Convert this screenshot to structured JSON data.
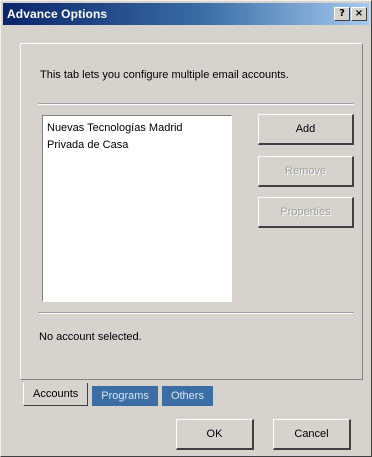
{
  "window": {
    "title": "Advance Options",
    "help_label": "?",
    "close_label": "×"
  },
  "accounts_tab": {
    "description": "This tab lets you configure multiple email accounts.",
    "accounts": [
      "Nuevas Tecnologías Madrid",
      "Privada de Casa"
    ],
    "buttons": {
      "add": "Add",
      "remove": "Remove",
      "properties": "Properties"
    },
    "status": "No account selected."
  },
  "tabs": [
    {
      "label": "Accounts",
      "active": true
    },
    {
      "label": "Programs",
      "active": false
    },
    {
      "label": "Others",
      "active": false
    }
  ],
  "footer": {
    "ok": "OK",
    "cancel": "Cancel"
  },
  "colors": {
    "face": "#d6d3ce",
    "title_start": "#0a246a",
    "title_end": "#a6caf0",
    "inactive_tab": "#3a6ea5"
  },
  "icons": {
    "help": "help-icon",
    "close": "close-icon"
  }
}
